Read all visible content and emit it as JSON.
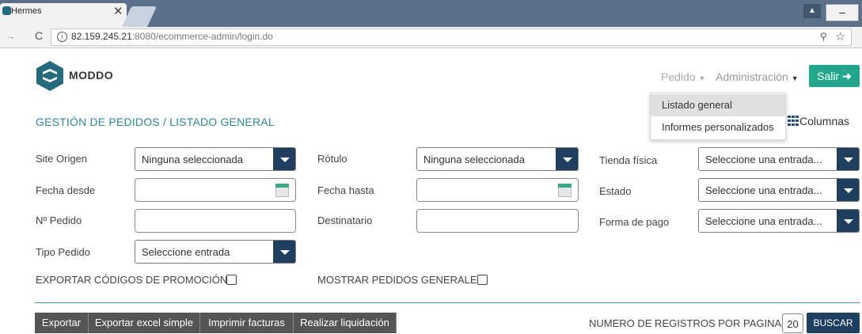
{
  "browser": {
    "tab_title": "Hermes",
    "url_host": "82.159.245.21",
    "url_path": ":8080/ecommerce-admin/login.do"
  },
  "header": {
    "brand": "MODDO",
    "nav_pedido": "Pedido",
    "nav_admin": "Administración",
    "salir_label": "Salir"
  },
  "dropdown": {
    "items": [
      "Listado general",
      "Informes personalizados"
    ]
  },
  "page": {
    "title": "GESTIÓN DE PEDIDOS / LISTADO GENERAL",
    "columns_label": "Columnas"
  },
  "filters": {
    "site_origen_label": "Site Origen",
    "site_origen_value": "Ninguna seleccionada",
    "rotulo_label": "Rótulo",
    "rotulo_value": "Ninguna seleccionada",
    "tienda_label": "Tienda física",
    "tienda_value": "Seleccione una entrada...",
    "fecha_desde_label": "Fecha desde",
    "fecha_hasta_label": "Fecha hasta",
    "estado_label": "Estado",
    "estado_value": "Seleccione una entrada...",
    "pedido_label": "Nº Pedido",
    "destinatario_label": "Destinatario",
    "forma_pago_label": "Forma de pago",
    "forma_pago_value": "Seleccione una entrada...",
    "tipo_pedido_label": "Tipo Pedido",
    "tipo_pedido_value": "Seleccione entrada",
    "exportar_codigos_label": "EXPORTAR CÓDIGOS DE PROMOCIÓN",
    "mostrar_generales_label": "MOSTRAR PEDIDOS GENERALES"
  },
  "actions": {
    "exportar": "Exportar",
    "exportar_excel": "Exportar excel simple",
    "imprimir": "Imprimir facturas",
    "liquidacion": "Realizar liquidación",
    "rpp_label": "NUMERO DE REGISTROS POR PAGINA",
    "rpp_value": "20",
    "buscar": "BUSCAR"
  },
  "colors": {
    "accent_teal": "#2d8a9b",
    "salir_green": "#23a78c",
    "select_dark": "#1e3f5f"
  }
}
